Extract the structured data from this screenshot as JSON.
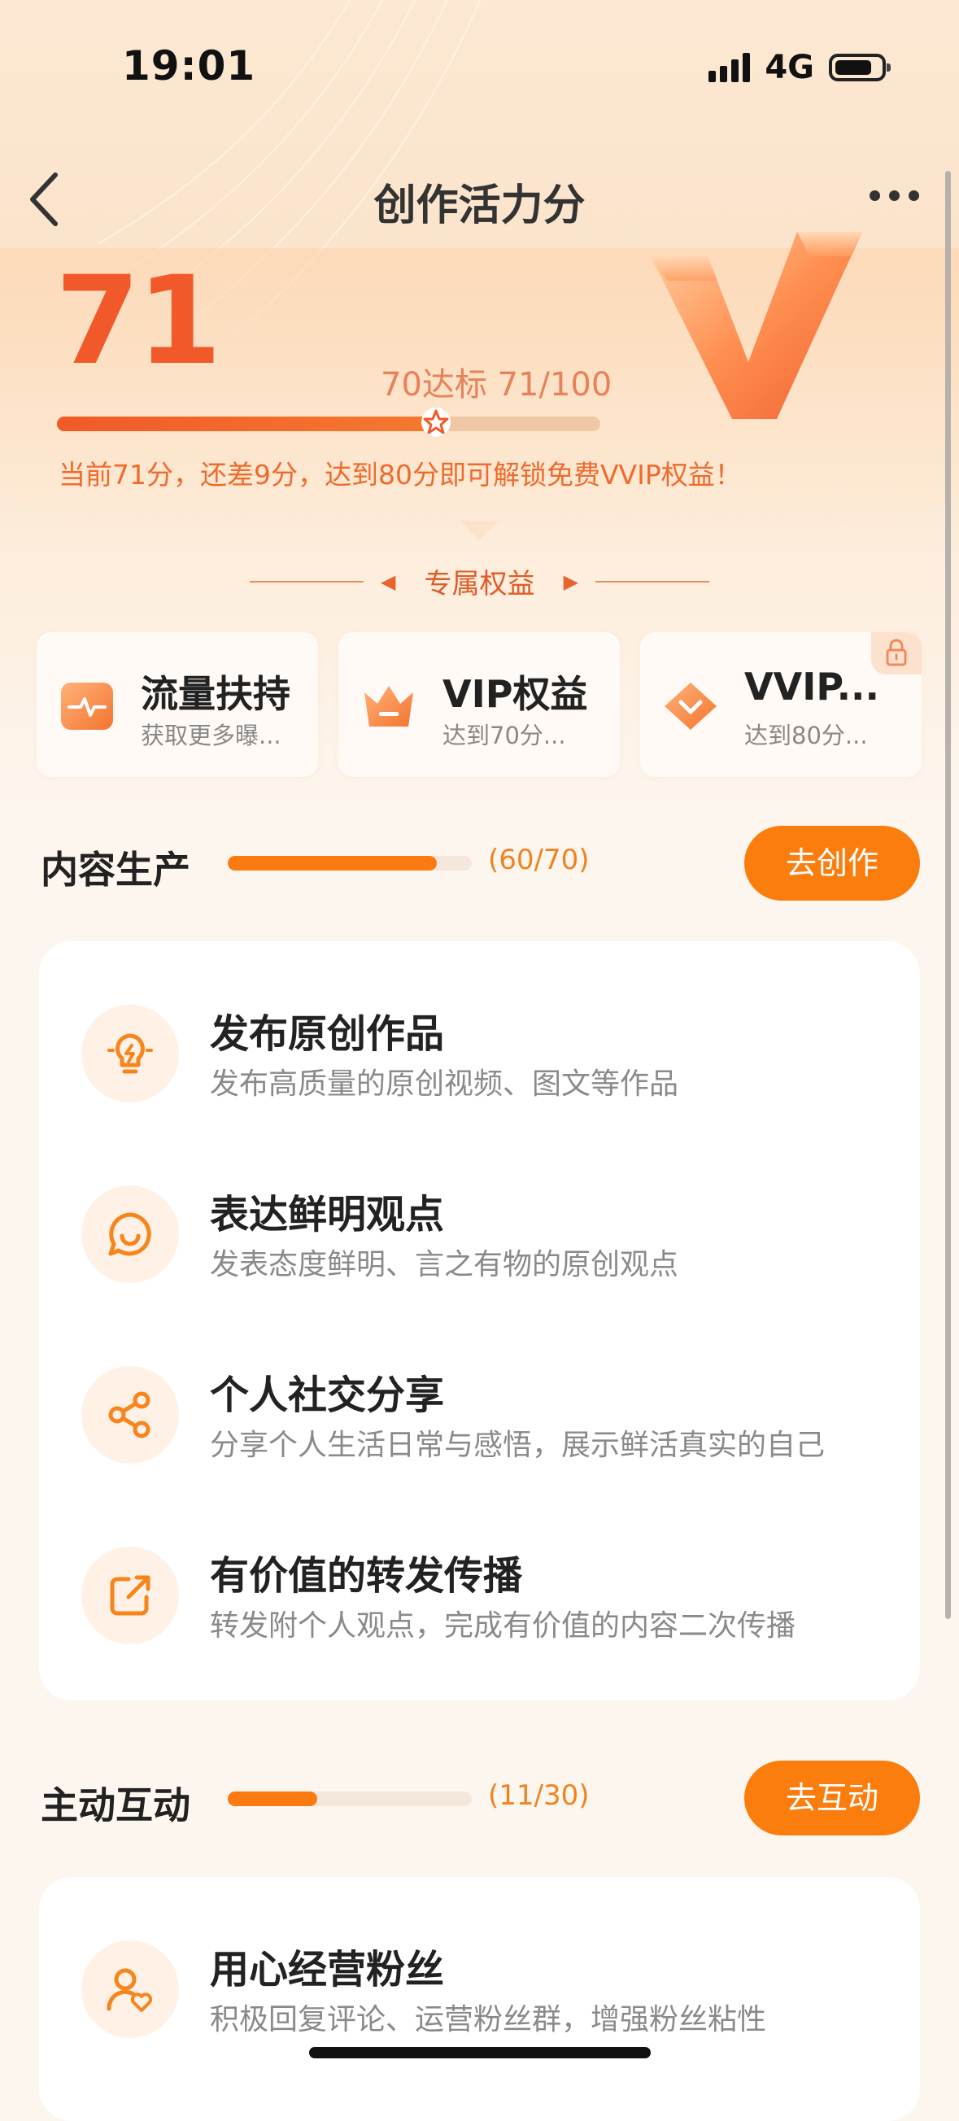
{
  "status_bar": {
    "time": "19:01",
    "network": "4G"
  },
  "nav": {
    "title": "创作活力分"
  },
  "score": {
    "value": "71",
    "target_text": "70达标 71/100",
    "progress": 0.71,
    "hint": "当前71分，还差9分，达到80分即可解锁免费VVIP权益！"
  },
  "benefits": {
    "heading": "专属权益",
    "cards": [
      {
        "title": "流量扶持",
        "subtitle": "获取更多曝...",
        "icon": "traffic-pulse-icon"
      },
      {
        "title": "VIP权益",
        "subtitle": "达到70分...",
        "icon": "crown-icon"
      },
      {
        "title": "VVIP...",
        "subtitle": "达到80分...",
        "icon": "diamond-icon",
        "locked": true
      }
    ]
  },
  "sections": [
    {
      "title": "内容生产",
      "count": "(60/70)",
      "progress": 0.857,
      "button": "去创作",
      "items": [
        {
          "title": "发布原创作品",
          "subtitle": "发布高质量的原创视频、图文等作品",
          "icon": "lightbulb-icon"
        },
        {
          "title": "表达鲜明观点",
          "subtitle": "发表态度鲜明、言之有物的原创观点",
          "icon": "chat-smile-icon"
        },
        {
          "title": "个人社交分享",
          "subtitle": "分享个人生活日常与感悟，展示鲜活真实的自己",
          "icon": "share-icon"
        },
        {
          "title": "有价值的转发传播",
          "subtitle": "转发附个人观点，完成有价值的内容二次传播",
          "icon": "forward-icon"
        }
      ]
    },
    {
      "title": "主动互动",
      "count": "(11/30)",
      "progress": 0.367,
      "button": "去互动",
      "items": [
        {
          "title": "用心经营粉丝",
          "subtitle": "积极回复评论、运营粉丝群，增强粉丝粘性",
          "icon": "fans-heart-icon"
        }
      ]
    }
  ],
  "colors": {
    "accent": "#f2592a",
    "button": "#fb7d0e",
    "score": "#f2592a"
  }
}
